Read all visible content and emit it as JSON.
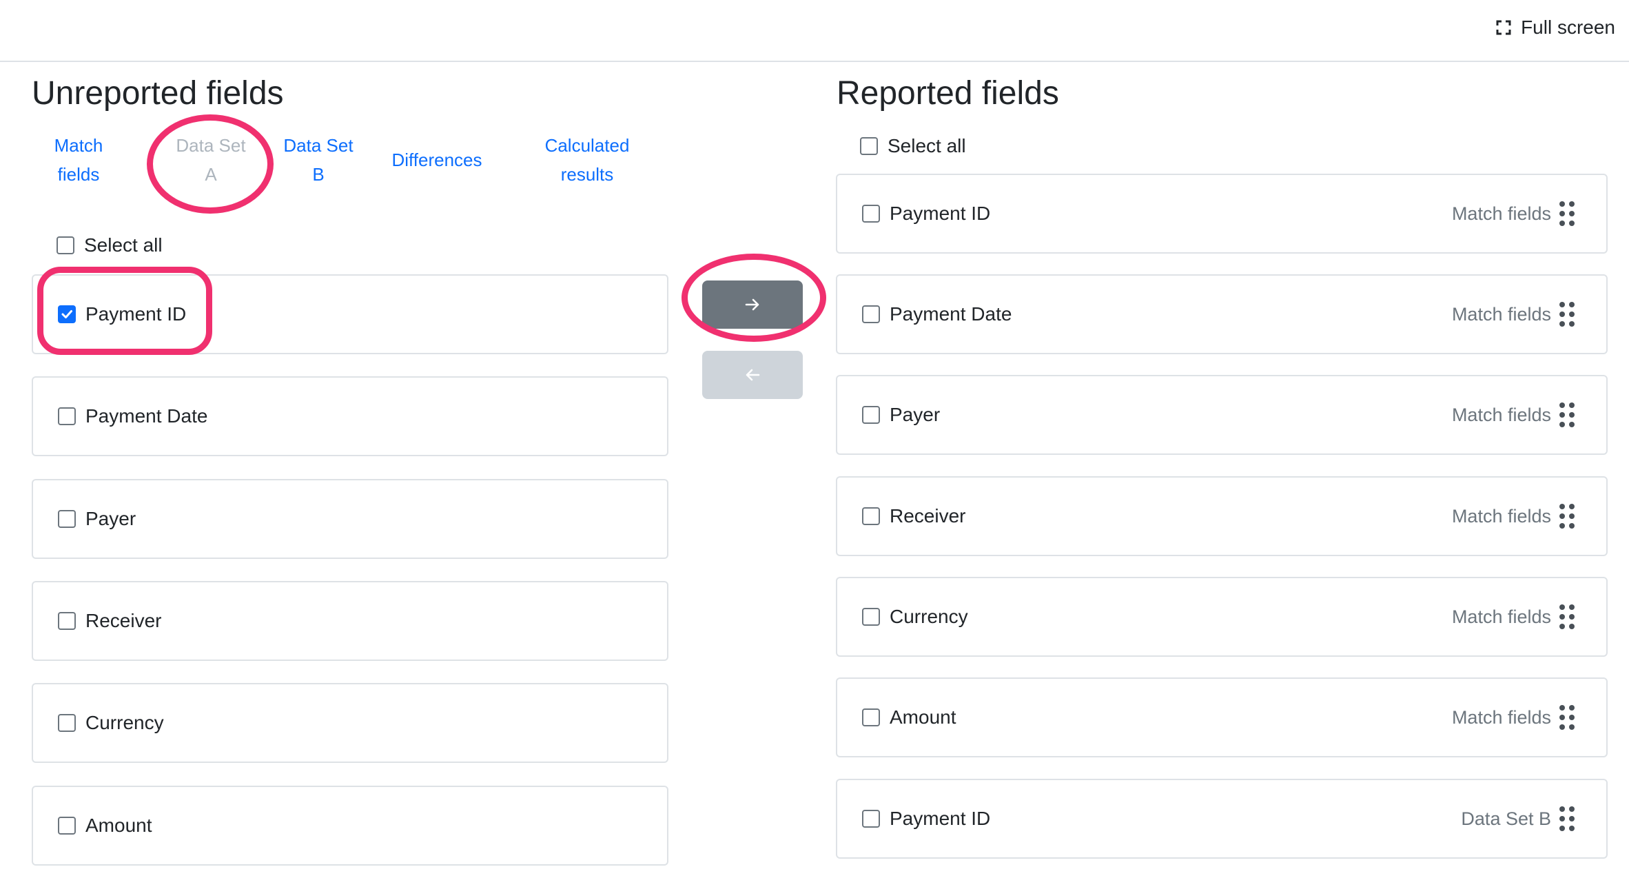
{
  "topbar": {
    "fullscreen_label": "Full screen",
    "fullscreen_icon": "expand-icon"
  },
  "left_panel": {
    "title": "Unreported fields",
    "tabs": [
      {
        "line1": "Match",
        "line2": "fields",
        "state": "link"
      },
      {
        "line1": "Data Set",
        "line2": "A",
        "state": "disabled"
      },
      {
        "line1": "Data Set",
        "line2": "B",
        "state": "link"
      },
      {
        "line1": "Differences",
        "line2": "",
        "state": "link"
      },
      {
        "line1": "Calculated",
        "line2": "results",
        "state": "link"
      }
    ],
    "select_all_label": "Select all",
    "fields": [
      {
        "label": "Payment ID",
        "checked": true
      },
      {
        "label": "Payment Date",
        "checked": false
      },
      {
        "label": "Payer",
        "checked": false
      },
      {
        "label": "Receiver",
        "checked": false
      },
      {
        "label": "Currency",
        "checked": false
      },
      {
        "label": "Amount",
        "checked": false
      }
    ]
  },
  "transfer": {
    "move_right_icon": "arrow-right-icon",
    "move_left_icon": "arrow-left-icon",
    "move_right_enabled": true,
    "move_left_enabled": false
  },
  "right_panel": {
    "title": "Reported fields",
    "select_all_label": "Select all",
    "fields": [
      {
        "label": "Payment ID",
        "source": "Match fields",
        "checked": false
      },
      {
        "label": "Payment Date",
        "source": "Match fields",
        "checked": false
      },
      {
        "label": "Payer",
        "source": "Match fields",
        "checked": false
      },
      {
        "label": "Receiver",
        "source": "Match fields",
        "checked": false
      },
      {
        "label": "Currency",
        "source": "Match fields",
        "checked": false
      },
      {
        "label": "Amount",
        "source": "Match fields",
        "checked": false
      },
      {
        "label": "Payment ID",
        "source": "Data Set B",
        "checked": false
      }
    ]
  },
  "colors": {
    "link": "#0d6efd",
    "disabled_tab": "#adb5bd",
    "primary_button": "#6c757d",
    "disabled_button": "#ced4da",
    "annotation": "#f0306f",
    "checkbox_checked": "#0d6efd"
  }
}
